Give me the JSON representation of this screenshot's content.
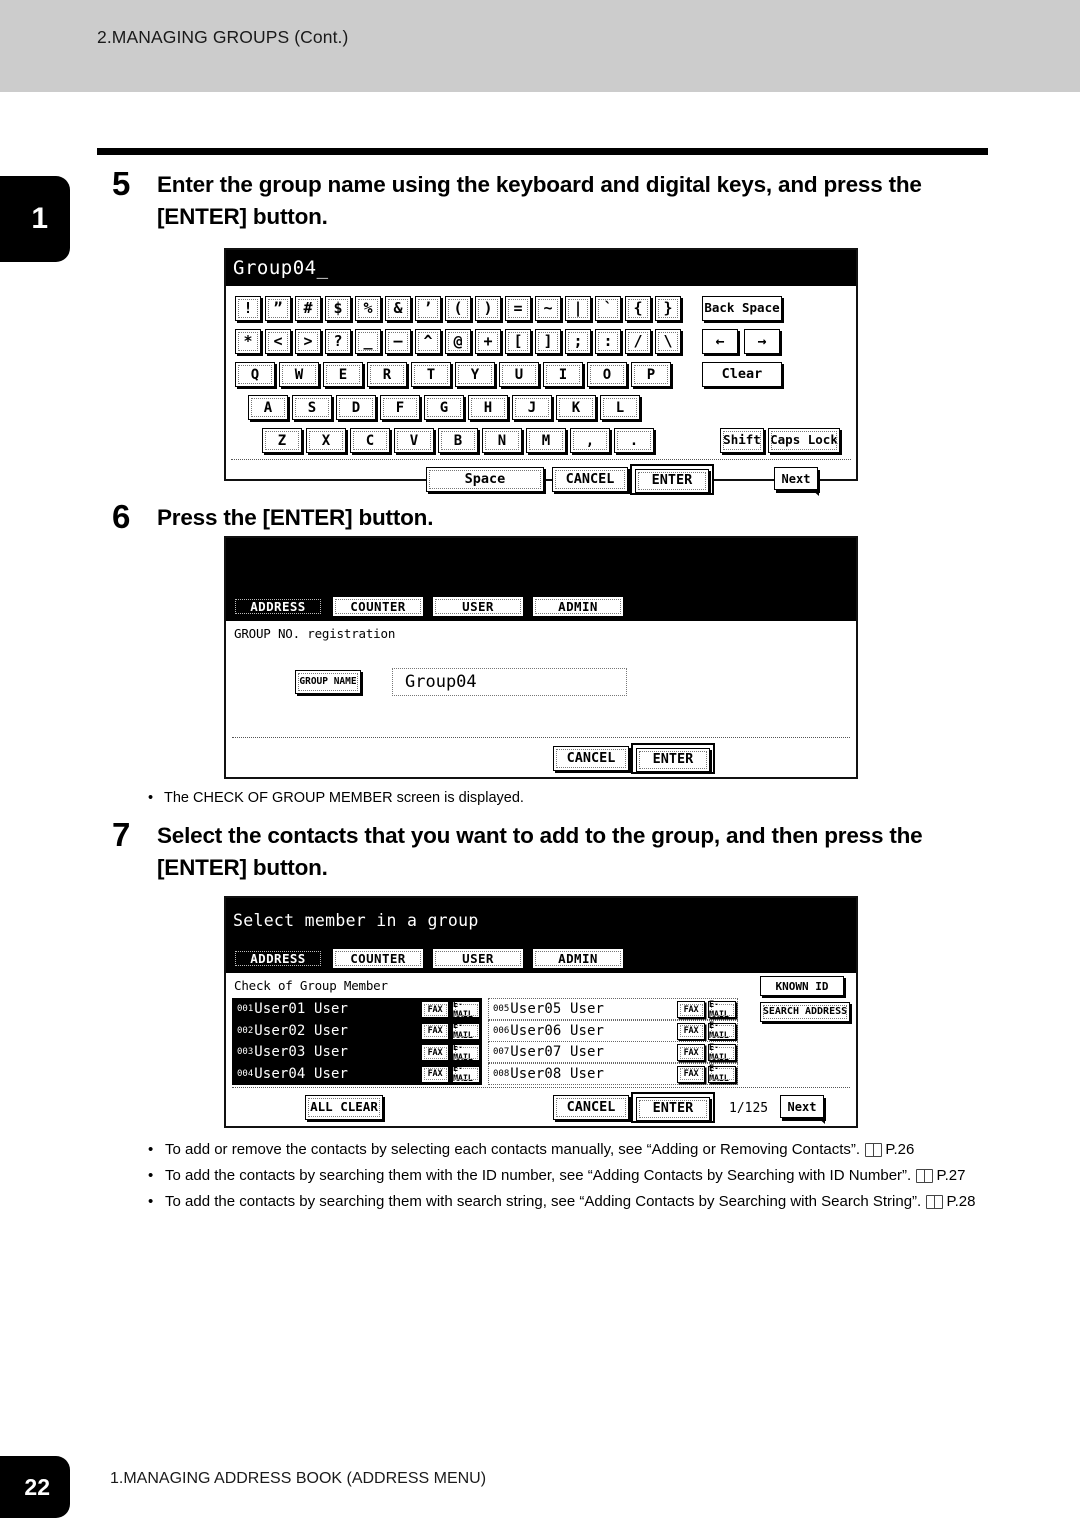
{
  "header": {
    "title": "2.MANAGING GROUPS (Cont.)"
  },
  "chapter_tab": {
    "number": "1"
  },
  "footer": {
    "page_number": "22",
    "title": "1.MANAGING ADDRESS BOOK (ADDRESS MENU)"
  },
  "steps": [
    {
      "number": "5",
      "text": "Enter the group name using the keyboard and digital keys, and press the [ENTER] button."
    },
    {
      "number": "6",
      "text": "Press the [ENTER] button."
    },
    {
      "number": "7",
      "text": "Select the contacts that you want to add to the group, and then press the [ENTER] button."
    }
  ],
  "step6_note": {
    "bullet": "•",
    "text": "The CHECK OF GROUP MEMBER screen is displayed."
  },
  "notes": [
    {
      "bullet": "•",
      "text_before": "To add or remove the contacts by selecting each contacts manually, see “Adding or Removing Contacts”.",
      "page_ref": "P.26"
    },
    {
      "bullet": "•",
      "text_before": "To add the contacts by searching them with the ID number, see “Adding Contacts by Searching with ID Number”.",
      "page_ref": "P.27"
    },
    {
      "bullet": "•",
      "text_before": "To add the contacts by searching them with search string, see “Adding Contacts by Searching with Search String”.",
      "page_ref": "P.28"
    }
  ],
  "keyboard_screen": {
    "input_value": "Group04_",
    "row1": [
      "!",
      "”",
      "#",
      "$",
      "%",
      "&",
      "’",
      "(",
      ")",
      "=",
      "~",
      "|",
      "`",
      "{",
      "}"
    ],
    "row2": [
      "*",
      "<",
      ">",
      "?",
      "_",
      "—",
      "^",
      "@",
      "+",
      "[",
      "]",
      ";",
      ":",
      "/",
      "\\"
    ],
    "row3": [
      "Q",
      "W",
      "E",
      "R",
      "T",
      "Y",
      "U",
      "I",
      "O",
      "P"
    ],
    "row4": [
      "A",
      "S",
      "D",
      "F",
      "G",
      "H",
      "J",
      "K",
      "L"
    ],
    "row5": [
      "Z",
      "X",
      "C",
      "V",
      "B",
      "N",
      "M",
      ",",
      "."
    ],
    "back_space": "Back Space",
    "arrow_left": "←",
    "arrow_right": "→",
    "clear": "Clear",
    "shift": "Shift",
    "caps_lock": "Caps Lock",
    "space": "Space",
    "cancel": "CANCEL",
    "enter": "ENTER",
    "next": "Next"
  },
  "group_screen": {
    "tabs": [
      {
        "label": "ADDRESS",
        "active": true
      },
      {
        "label": "COUNTER",
        "active": false
      },
      {
        "label": "USER",
        "active": false
      },
      {
        "label": "ADMIN",
        "active": false
      }
    ],
    "screen_label": "GROUP NO. registration",
    "group_name_button": "GROUP NAME",
    "group_name_value": "Group04",
    "cancel": "CANCEL",
    "enter": "ENTER"
  },
  "member_screen": {
    "title": "Select member in a group",
    "tabs": [
      {
        "label": "ADDRESS",
        "active": true
      },
      {
        "label": "COUNTER",
        "active": false
      },
      {
        "label": "USER",
        "active": false
      },
      {
        "label": "ADMIN",
        "active": false
      }
    ],
    "screen_label": "Check of Group Member",
    "known_id": "KNOWN ID",
    "search_address": "SEARCH ADDRESS",
    "fax_label": "FAX",
    "email_label": "E-MAIL",
    "contacts_left": [
      {
        "id": "001",
        "name": "User01 User",
        "selected": true
      },
      {
        "id": "002",
        "name": "User02 User",
        "selected": true
      },
      {
        "id": "003",
        "name": "User03 User",
        "selected": true
      },
      {
        "id": "004",
        "name": "User04 User",
        "selected": true
      }
    ],
    "contacts_right": [
      {
        "id": "005",
        "name": "User05 User",
        "selected": false
      },
      {
        "id": "006",
        "name": "User06 User",
        "selected": false
      },
      {
        "id": "007",
        "name": "User07 User",
        "selected": false
      },
      {
        "id": "008",
        "name": "User08 User",
        "selected": false
      }
    ],
    "all_clear": "ALL CLEAR",
    "cancel": "CANCEL",
    "enter": "ENTER",
    "page_count": "1/125",
    "next": "Next"
  }
}
